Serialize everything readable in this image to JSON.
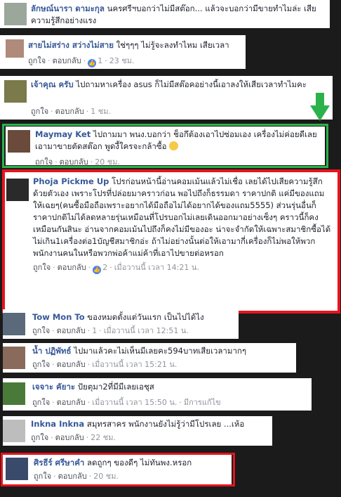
{
  "comments": [
    {
      "id": "c1",
      "name": "ลักษณ์นารา ดามะกุล",
      "text": "นครศรีฯบอกว่าไม่มีสต๊อก... แล้วจะบอกว่ามีขายทำไมล่ะ เสียความรู้สึกอย่างแรง",
      "like": "ถูกใจ",
      "reply": "ตอบกลับ",
      "likes": "",
      "time": ""
    },
    {
      "id": "c2",
      "name": "สายไม่สร่าง สว่างไม่สาย",
      "text": "ใช่ๆๆๆ ไม่รู้จะลงทำไหม เสียเวลา",
      "like": "ถูกใจ",
      "reply": "ตอบกลับ",
      "likes": "1",
      "time": "23 ชม."
    },
    {
      "id": "c3",
      "name": "เจ้าคุณ ครับ",
      "text": "ไปถามหาเครื่อง asus ก็ไม่มีสต๊อคอย่างนี้เอาลงให้เสียเวลาทำไมคะ",
      "like": "ถูกใจ",
      "reply": "ตอบกลับ",
      "likes": "",
      "time": "1 ชม."
    },
    {
      "id": "c4",
      "name": "Maymay Ket",
      "text": "ไปถามมา พนง.บอกว่า ช็อกึต้องเอาไปซ่อมเอง เครื่องไม่ค่อยดีเลยเอามาขายตัดสต๊อก พูดงี้ใครจะกล้าซื้อ",
      "like": "ถูกใจ",
      "reply": "ตอบกลับ",
      "likes": "",
      "time": "20 ชม."
    },
    {
      "id": "c5",
      "name": "Phoja Pickme Up",
      "text": "โปรก่อนหน้านี้อ่านคอมเม้นแล้วไม่เชื่อ เลยได้ไปเสียความรู้สึกด้วยตัวเอง เพราะโปรที่ปล่อยมาคราวก่อน พอไปถึงก็ธรรมดา ราคาปกติ แค่มีของแถมให้เฉยๆ(คนซื้อมือถือเพราะอยากได้มือถือไม่ได้อยากได้ของแถม5555) ส่วนรุ่นอื่นก็ราคาปกติไม่ได้ลดหลายรุ่นเหมือนที่โปรบอกไม่เลยเดินออกมาอย่างเซ็งๆ คราวนี้ก็คงเหมือนกันสินะ อ่านจากคอมเม้นไปถึงก็คงไม่มีของอะ น่าจะจำกัดให้เฉพาะสมาชิกซื้อได้ไม่เกิน1เครื่องต่อ1บัญชีสมาชิกอ่ะ ถ้าไม่อย่างนั้นต่อให้เอามากี่เครื่องก็ไม่พอให้พวกพนักงานคนในหรือพวกพ่อค้าแม่ค้าที่เอาไปขายต่อหรอก",
      "like": "ถูกใจ",
      "reply": "ตอบกลับ",
      "likes": "2",
      "time": "เมื่อวานนี้ เวลา 14:21 น."
    },
    {
      "id": "c6",
      "name": "Tow Mon To",
      "text": "ของหมดตั้งแต่วันแรก เป็นไปได้ไง",
      "like": "ถูกใจ",
      "reply": "ตอบกลับ",
      "likes": "1",
      "time": "เมื่อวานนี้ เวลา 12:51 น."
    },
    {
      "id": "c7",
      "name": "น้ำ ปฏิพัทธ์",
      "text": "ไปมาแล้วคะไม่เห็นมีเลยคะ594บาทเสียเวลามากๆ",
      "like": "ถูกใจ",
      "reply": "ตอบกลับ",
      "likes": "",
      "time": "เมื่อวานนี้ เวลา 15:21 น."
    },
    {
      "id": "c8",
      "name": "เจจาะ คัยาะ",
      "text": "ปัยตุมา2ที่มีมีเลยเอชุส",
      "like": "ถูกใจ",
      "reply": "ตอบกลับ",
      "likes": "",
      "time": "เมื่อวานนี้ เวลา 15:50 น.",
      "edited": "มีการแก้ไข"
    },
    {
      "id": "c9",
      "name": "Inkna Inkna",
      "text": "สมุทรสาคร พนักงานยังไม่รู้ว่ามีโปรเลย ...เห้อ",
      "like": "ถูกใจ",
      "reply": "ตอบกลับ",
      "likes": "",
      "time": "22 ชม."
    },
    {
      "id": "c10",
      "name": "ศิรธีร์ ศรีษาคำ",
      "text": "ลดถูกๆ ของดีๆ ไม่ทันพง.หรอก",
      "like": "ถูกใจ",
      "reply": "ตอบกลับ",
      "likes": "",
      "time": "20 ชม."
    }
  ],
  "colors": {
    "highlight_green": "#2bb24c",
    "highlight_red": "#e6141e",
    "link": "#365899"
  },
  "icons": {
    "like_badge": "thumbs-up-icon",
    "arrow": "down-arrow-icon",
    "emoji": "sad-face-icon"
  }
}
